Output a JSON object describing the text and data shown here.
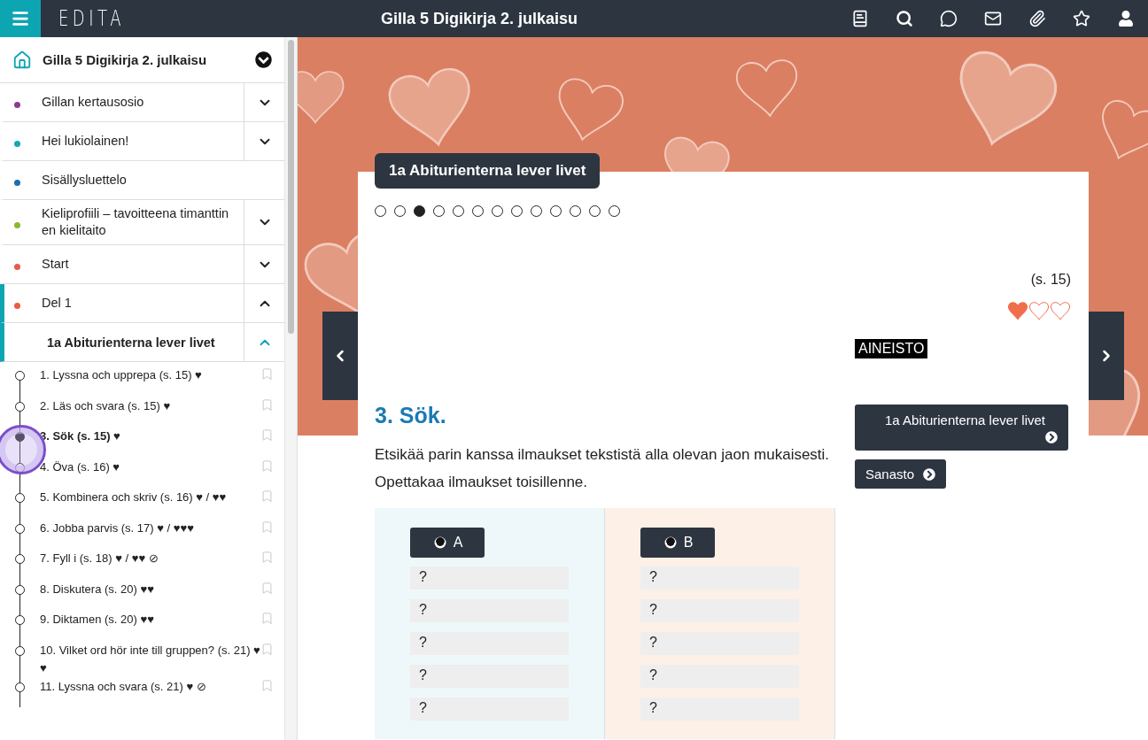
{
  "topbar": {
    "logo": "EDITA",
    "title": "Gilla 5 Digikirja 2. julkaisu"
  },
  "sidebar": {
    "title": "Gilla 5 Digikirja 2. julkaisu",
    "sections": [
      {
        "label": "Gillan kertausosio",
        "color": "#8e3a8f",
        "expanded": false,
        "selected": false
      },
      {
        "label": "Hei lukiolainen!",
        "color": "#13a8b8",
        "expanded": false,
        "selected": false
      },
      {
        "label": "Sisällysluettelo",
        "color": "#1a6fb0",
        "selected": false
      },
      {
        "label": "Kieliprofiili – tavoitteena timanttinen kielitaito",
        "color": "#8ab82e",
        "expanded": false,
        "selected": false
      },
      {
        "label": "Start",
        "color": "#e85c41",
        "expanded": false,
        "selected": false
      },
      {
        "label": "Del 1",
        "color": "#e85c41",
        "expanded": true,
        "selected": true,
        "children": [
          {
            "label": "1a Abiturienterna lever livet",
            "expanded": true,
            "selected": true,
            "children": [
              {
                "label": "1. Lyssna och upprepa (s. 15) ♥",
                "selected": false
              },
              {
                "label": "2. Läs och svara (s. 15) ♥",
                "selected": false
              },
              {
                "label": "3. Sök (s. 15) ♥",
                "selected": true
              },
              {
                "label": "4. Öva (s. 16) ♥",
                "selected": false
              },
              {
                "label": "5. Kombinera och skriv (s. 16) ♥ / ♥♥",
                "selected": false
              },
              {
                "label": "6. Jobba parvis (s. 17) ♥ / ♥♥♥",
                "selected": false
              },
              {
                "label": "7. Fyll i (s. 18) ♥ / ♥♥ ⊘",
                "selected": false
              },
              {
                "label": "8. Diskutera (s. 20) ♥♥",
                "selected": false
              },
              {
                "label": "9. Diktamen (s. 20) ♥♥",
                "selected": false
              },
              {
                "label": "10. Vilket ord hör inte till gruppen? (s. 21) ♥♥",
                "selected": false
              },
              {
                "label": "11. Lyssna och svara (s. 21) ♥ ⊘",
                "selected": false
              }
            ]
          }
        ]
      }
    ]
  },
  "lesson": {
    "tab": "1a Abiturienterna lever livet",
    "pages": [
      {
        "selected": false
      },
      {
        "selected": false
      },
      {
        "selected": true
      },
      {
        "selected": false
      },
      {
        "selected": false
      },
      {
        "selected": false
      },
      {
        "selected": false
      },
      {
        "selected": false
      },
      {
        "selected": false
      },
      {
        "selected": false
      },
      {
        "selected": false
      },
      {
        "selected": false
      },
      {
        "selected": false
      }
    ],
    "page_ref": "(s. 15)",
    "difficulty": {
      "stars": 1
    },
    "material_tag": "AINEISTO",
    "heading": "3. Sök.",
    "instructions": "Etsikää parin kanssa ilmaukset tekstistä alla olevan jaon mukaisesti. Opettakaa ilmaukset toisillenne.",
    "groups": [
      {
        "label": "A",
        "color": "#eef8fb",
        "cells": [
          "?",
          "?",
          "?",
          "?",
          "?"
        ]
      },
      {
        "label": "B",
        "color": "#fdf0e6",
        "cells": [
          "?",
          "?",
          "?",
          "?",
          "?"
        ]
      }
    ],
    "links": [
      {
        "label": "1a Abiturienterna lever livet"
      },
      {
        "label": "Sanasto"
      }
    ]
  }
}
